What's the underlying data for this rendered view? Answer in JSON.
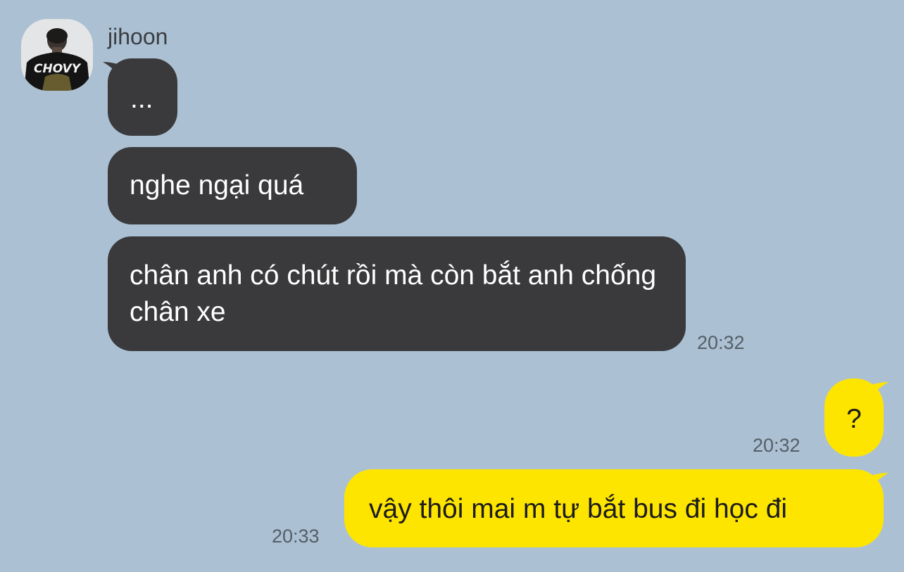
{
  "chat": {
    "sender_name": "jihoon",
    "avatar_shirt_text": "CHOVY",
    "messages": [
      {
        "direction": "incoming",
        "text": "...",
        "time": ""
      },
      {
        "direction": "incoming",
        "text": "nghe ngại quá",
        "time": ""
      },
      {
        "direction": "incoming",
        "text": "chân anh có chút rồi mà còn bắt anh chống chân xe",
        "time": "20:32"
      },
      {
        "direction": "outgoing",
        "text": "?",
        "time": "20:32"
      },
      {
        "direction": "outgoing",
        "text": "vậy thôi mai m tự bắt bus đi học đi",
        "time": "20:33"
      }
    ]
  },
  "colors": {
    "background": "#abc1d3",
    "incoming_bubble": "#3a3a3c",
    "outgoing_bubble": "#fee500",
    "timestamp": "#565e66"
  }
}
